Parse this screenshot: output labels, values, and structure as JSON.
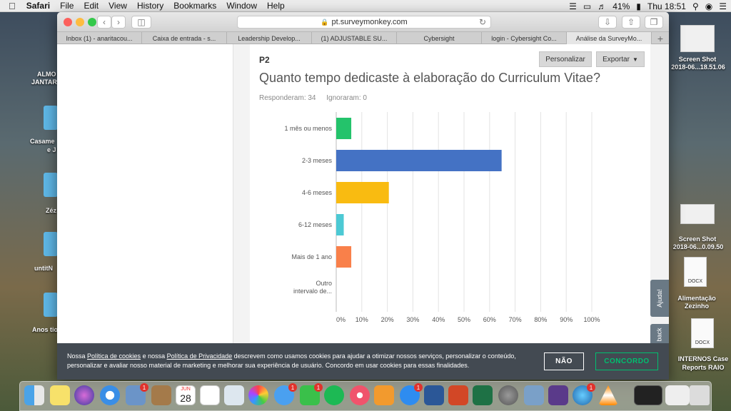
{
  "menubar": {
    "app": "Safari",
    "items": [
      "File",
      "Edit",
      "View",
      "History",
      "Bookmarks",
      "Window",
      "Help"
    ],
    "battery": "41%",
    "clock": "Thu 18:51"
  },
  "desktop": {
    "left_labels": [
      "ALMO",
      "JANTAR",
      "Casame",
      "e J",
      "Zéz",
      "untitN",
      "Anos tio"
    ],
    "right_items": [
      {
        "label1": "Screen Shot",
        "label2": "2018-06...18.51.06"
      },
      {
        "label1": "Screen Shot",
        "label2": "2018-06...0.09.50"
      },
      {
        "label1": "Alimentação",
        "label2": "Zezinho",
        "type": "DOCX"
      },
      {
        "label1": "INTERNOS Case",
        "label2": "Reports RAIO",
        "type": "DOCX"
      }
    ]
  },
  "browser": {
    "url": "pt.surveymonkey.com",
    "tabs": [
      "Inbox (1) - anaritacou...",
      "Caixa de entrada - s...",
      "Leadership Develop...",
      "(1) ADJUSTABLE SU...",
      "Cybersight",
      "login - Cybersight Co...",
      "Análise da SurveyMo..."
    ]
  },
  "question": {
    "number": "P2",
    "title": "Quanto tempo dedicaste à elaboração do Curriculum Vitae?",
    "answered": "Responderam: 34",
    "skipped": "Ignoraram: 0",
    "customize": "Personalizar",
    "export": "Exportar"
  },
  "side_tabs": {
    "help": "Ajuda!",
    "feedback": "back"
  },
  "chart_data": {
    "type": "bar",
    "orientation": "horizontal",
    "categories": [
      "1 mês ou menos",
      "2-3 meses",
      "4-6 meses",
      "6-12 meses",
      "Mais de 1 ano",
      "Outro intervalo de..."
    ],
    "values": [
      5.88,
      64.71,
      20.59,
      2.94,
      5.88,
      0
    ],
    "colors": [
      "#24c36b",
      "#4472c4",
      "#f9bb11",
      "#4cc9d4",
      "#f9804a",
      "#888888"
    ],
    "xlim": [
      0,
      100
    ],
    "ticks": [
      "0%",
      "10%",
      "20%",
      "30%",
      "40%",
      "50%",
      "60%",
      "70%",
      "80%",
      "90%",
      "100%"
    ],
    "grid": true
  },
  "cookie": {
    "t1": "Nossa ",
    "link1": "Política de cookies",
    "t2": " e nossa ",
    "link2": "Política de Privacidade",
    "t3": " descrevem como usamos cookies para ajudar a otimizar nossos serviços, personalizar o conteúdo, personalizar e avaliar nosso material de marketing e melhorar sua experiência de usuário. Concordo em usar cookies para essas finalidades.",
    "decline": "NÃO",
    "accept": "CONCORDO"
  },
  "dock": {
    "calendar_month": "JUN",
    "calendar_day": "28"
  }
}
